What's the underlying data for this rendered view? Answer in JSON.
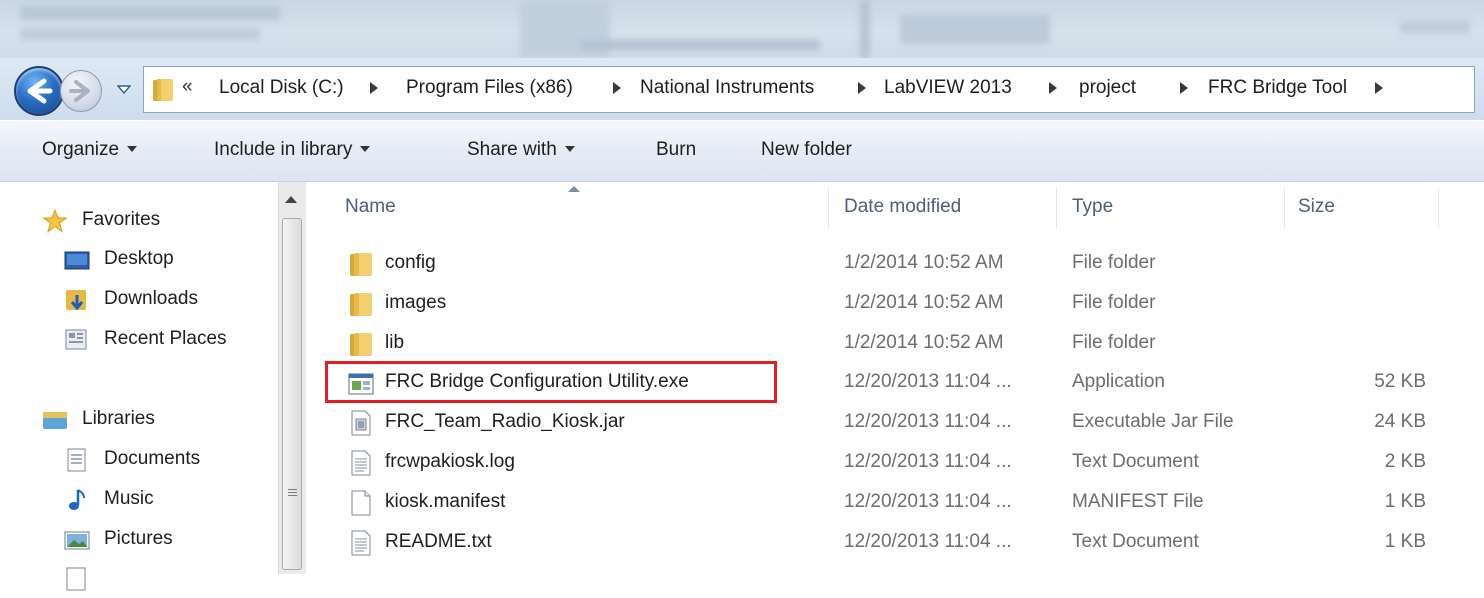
{
  "address": {
    "overflow_label": "«",
    "crumbs": [
      "Local Disk (C:)",
      "Program Files (x86)",
      "National Instruments",
      "LabVIEW 2013",
      "project",
      "FRC Bridge Tool"
    ]
  },
  "toolbar": {
    "organize": "Organize",
    "include_in_library": "Include in library",
    "share_with": "Share with",
    "burn": "Burn",
    "new_folder": "New folder"
  },
  "nav_pane": {
    "favorites": "Favorites",
    "desktop": "Desktop",
    "downloads": "Downloads",
    "recent_places": "Recent Places",
    "libraries": "Libraries",
    "documents": "Documents",
    "music": "Music",
    "pictures": "Pictures"
  },
  "columns": {
    "name": "Name",
    "date_modified": "Date modified",
    "type": "Type",
    "size": "Size"
  },
  "files": [
    {
      "name": "config",
      "date": "1/2/2014 10:52 AM",
      "type": "File folder",
      "size": "",
      "icon": "folder-icon"
    },
    {
      "name": "images",
      "date": "1/2/2014 10:52 AM",
      "type": "File folder",
      "size": "",
      "icon": "folder-icon"
    },
    {
      "name": "lib",
      "date": "1/2/2014 10:52 AM",
      "type": "File folder",
      "size": "",
      "icon": "folder-icon"
    },
    {
      "name": "FRC Bridge Configuration Utility.exe",
      "date": "12/20/2013 11:04 ...",
      "type": "Application",
      "size": "52 KB",
      "icon": "application-icon"
    },
    {
      "name": "FRC_Team_Radio_Kiosk.jar",
      "date": "12/20/2013 11:04 ...",
      "type": "Executable Jar File",
      "size": "24 KB",
      "icon": "jar-file-icon"
    },
    {
      "name": "frcwpakiosk.log",
      "date": "12/20/2013 11:04 ...",
      "type": "Text Document",
      "size": "2 KB",
      "icon": "text-document-icon"
    },
    {
      "name": "kiosk.manifest",
      "date": "12/20/2013 11:04 ...",
      "type": "MANIFEST File",
      "size": "1 KB",
      "icon": "generic-file-icon"
    },
    {
      "name": "README.txt",
      "date": "12/20/2013 11:04 ...",
      "type": "Text Document",
      "size": "1 KB",
      "icon": "text-document-icon"
    }
  ],
  "colors": {
    "highlight_border": "#e01e24",
    "column_header": "#4c607a",
    "detail_text": "#6d6d6d",
    "folder_yellow": "#e9c65a"
  }
}
